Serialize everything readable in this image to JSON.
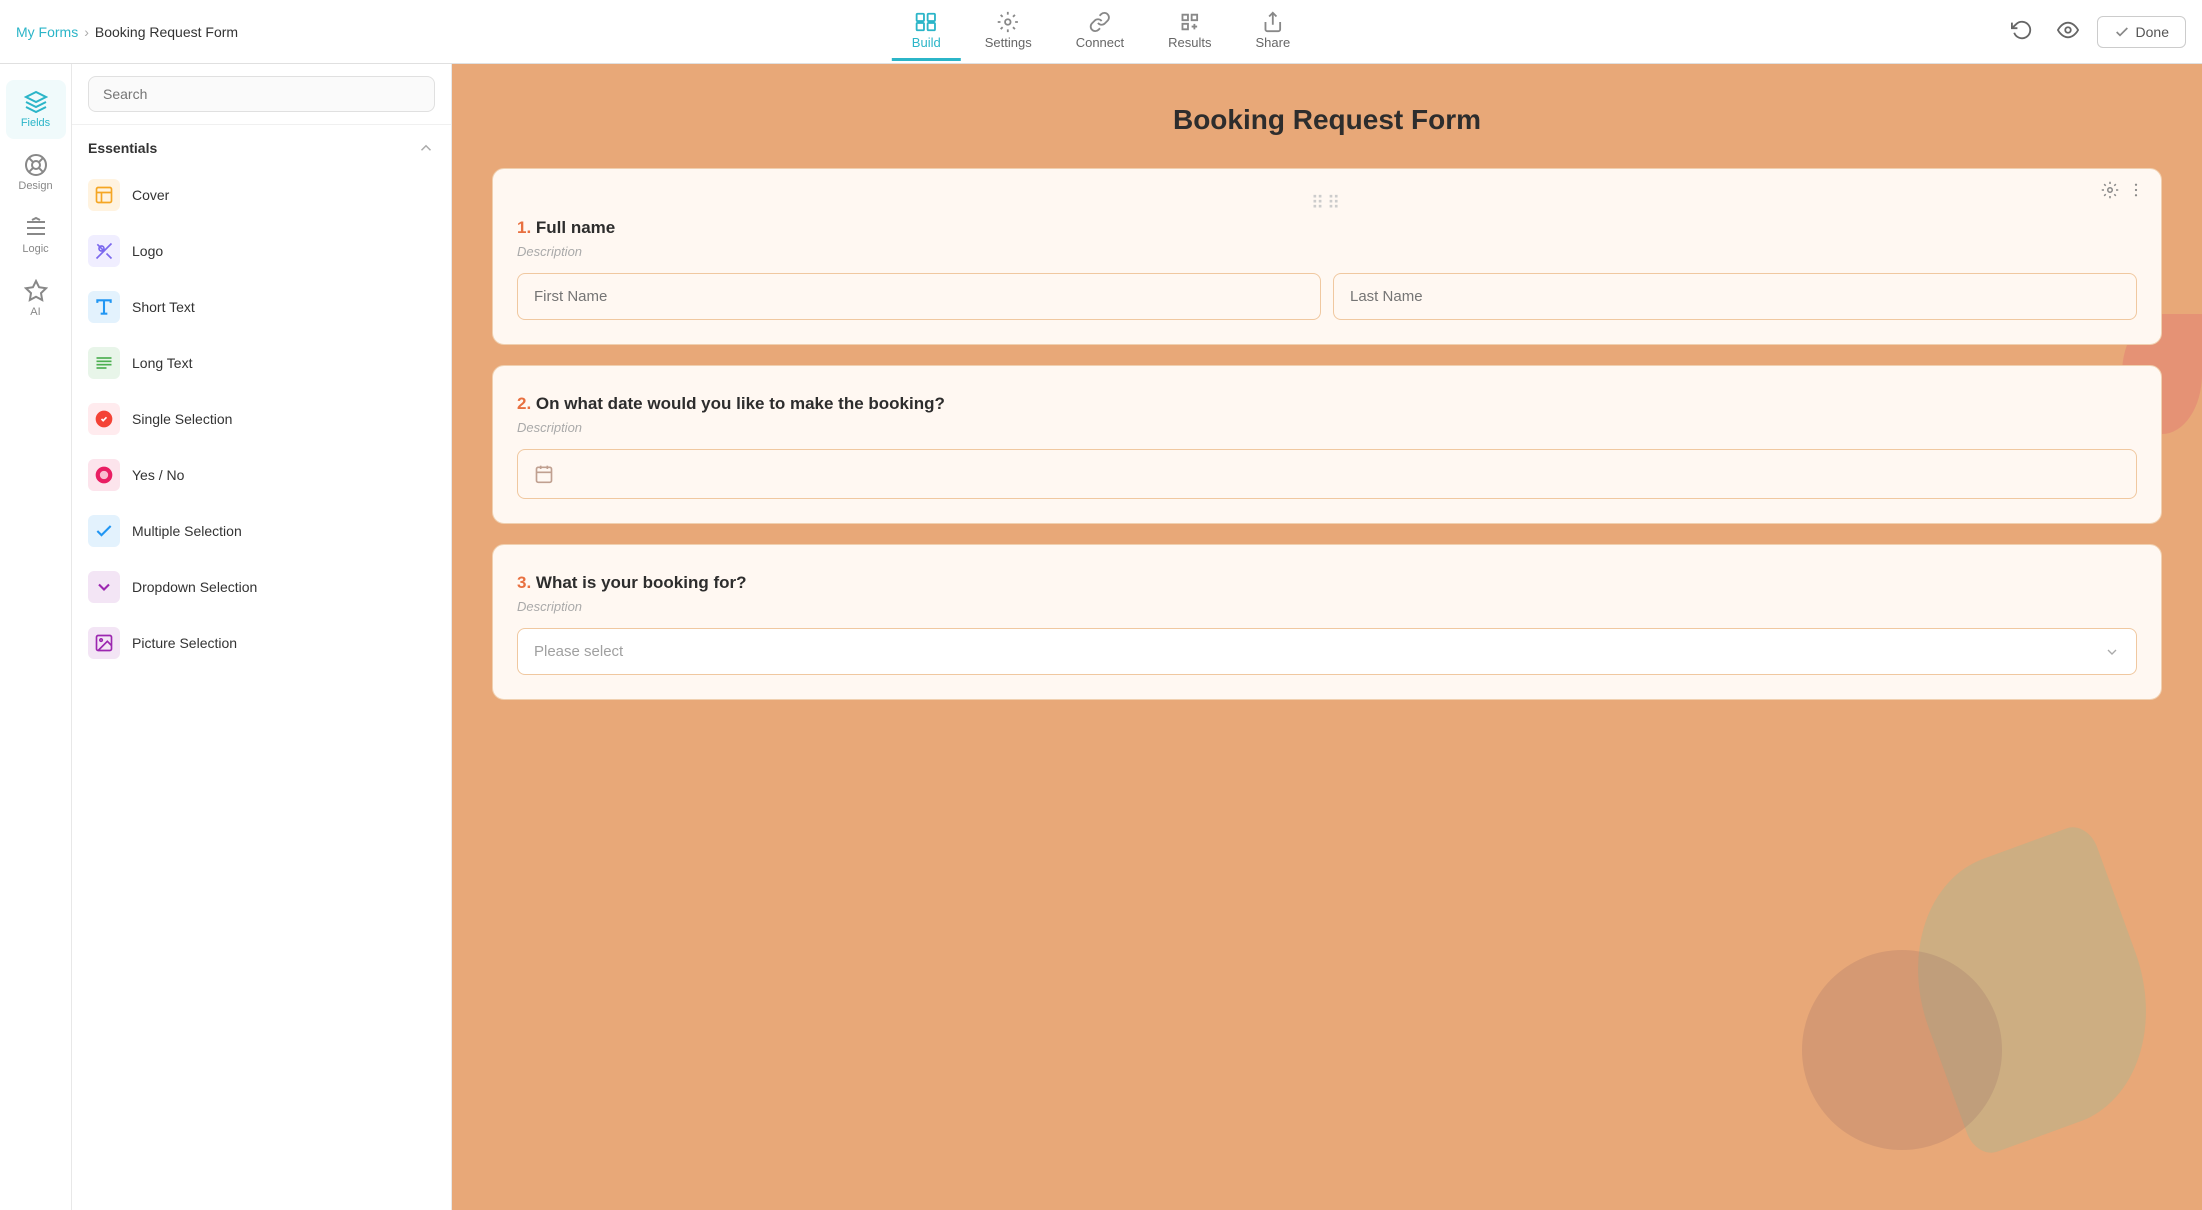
{
  "header": {
    "breadcrumb_home": "My Forms",
    "breadcrumb_separator": "›",
    "breadcrumb_form": "Booking Request Form",
    "done_label": "Done",
    "tabs": [
      {
        "id": "build",
        "label": "Build",
        "active": true
      },
      {
        "id": "settings",
        "label": "Settings",
        "active": false
      },
      {
        "id": "connect",
        "label": "Connect",
        "active": false
      },
      {
        "id": "results",
        "label": "Results",
        "active": false
      },
      {
        "id": "share",
        "label": "Share",
        "active": false
      }
    ]
  },
  "sidebar_icons": [
    {
      "id": "fields",
      "label": "Fields",
      "active": true
    },
    {
      "id": "design",
      "label": "Design",
      "active": false
    },
    {
      "id": "logic",
      "label": "Logic",
      "active": false
    },
    {
      "id": "ai",
      "label": "AI",
      "active": false
    }
  ],
  "fields_panel": {
    "search_placeholder": "Search",
    "essentials_label": "Essentials",
    "field_items": [
      {
        "id": "cover",
        "label": "Cover",
        "color": "#f5a623"
      },
      {
        "id": "logo",
        "label": "Logo",
        "color": "#7b68ee"
      },
      {
        "id": "short-text",
        "label": "Short Text",
        "color": "#2196f3"
      },
      {
        "id": "long-text",
        "label": "Long Text",
        "color": "#4caf50"
      },
      {
        "id": "single-selection",
        "label": "Single Selection",
        "color": "#f44336"
      },
      {
        "id": "yes-no",
        "label": "Yes / No",
        "color": "#e91e63"
      },
      {
        "id": "multiple-selection",
        "label": "Multiple Selection",
        "color": "#2196f3"
      },
      {
        "id": "dropdown-selection",
        "label": "Dropdown Selection",
        "color": "#9c27b0"
      },
      {
        "id": "picture-selection",
        "label": "Picture Selection",
        "color": "#9c27b0"
      }
    ]
  },
  "form": {
    "title": "Booking Request Form",
    "questions": [
      {
        "number": "1.",
        "label": "Full name",
        "description": "Description",
        "type": "fullname",
        "first_name_placeholder": "First Name",
        "last_name_placeholder": "Last Name"
      },
      {
        "number": "2.",
        "label": "On what date would you like to make the booking?",
        "description": "Description",
        "type": "date"
      },
      {
        "number": "3.",
        "label": "What is your booking for?",
        "description": "Description",
        "type": "dropdown",
        "placeholder": "Please select"
      }
    ]
  }
}
